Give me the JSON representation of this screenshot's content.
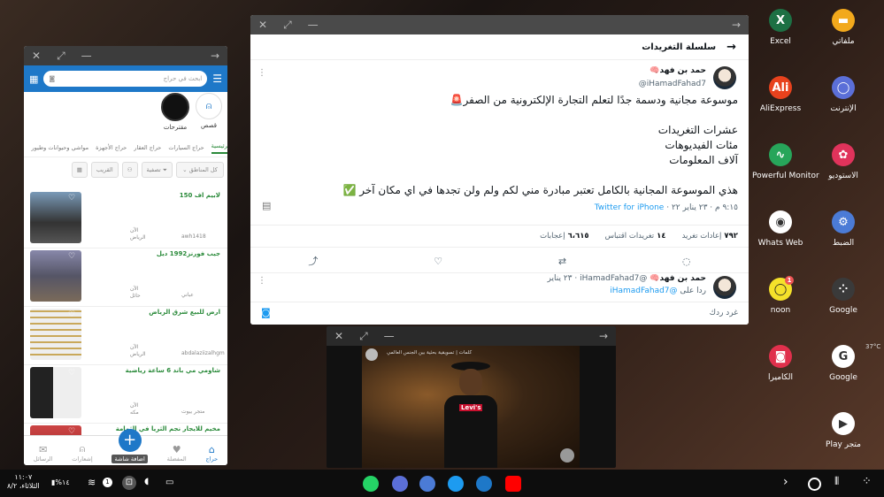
{
  "desktop": {
    "apps": [
      {
        "label": "Excel",
        "icon": "excel-icon",
        "color": "#1d7044",
        "glyph": "X"
      },
      {
        "label": "ملفاتي",
        "icon": "folder-icon",
        "color": "#f2a91c",
        "glyph": "▬"
      },
      {
        "label": "AliExpress",
        "icon": "aliexpress-icon",
        "color": "#e8421d",
        "glyph": "Ali"
      },
      {
        "label": "الإنترنت",
        "icon": "browser-icon",
        "color": "#5b6fd8",
        "glyph": "◯"
      },
      {
        "label": "Powerful Monitor",
        "icon": "monitor-icon",
        "color": "#27a55a",
        "glyph": "∿"
      },
      {
        "label": "الاستوديو",
        "icon": "gallery-icon",
        "color": "#e0335b",
        "glyph": "✿"
      },
      {
        "label": "Whats Web",
        "icon": "whatsweb-icon",
        "color": "#ffffff",
        "glyph": "◉"
      },
      {
        "label": "الضبط",
        "icon": "settings-icon",
        "color": "#4b7bd6",
        "glyph": "⚙"
      },
      {
        "label": "noon",
        "icon": "noon-icon",
        "color": "#f5e12a",
        "glyph": "◯"
      },
      {
        "label": "Google",
        "icon": "google-folder-icon",
        "color": "#3a3a3a",
        "glyph": "⁘"
      },
      {
        "label": "الكاميرا",
        "icon": "camera-icon",
        "color": "#e0304c",
        "glyph": "◙"
      },
      {
        "label": "Google",
        "icon": "google-icon",
        "color": "#ffffff",
        "glyph": "G"
      },
      {
        "label": "Play متجر",
        "icon": "play-store-icon",
        "color": "#ffffff",
        "glyph": "▶"
      }
    ],
    "noon_badge": "1",
    "temperature": "37°C"
  },
  "haraj": {
    "search_placeholder": "ابحث في حراج",
    "stories": [
      {
        "label": "مقترحات"
      },
      {
        "label": "قصص"
      }
    ],
    "tabs": [
      "الرئيسية",
      "حراج السيارات",
      "حراج العقار",
      "حراج الأجهزة",
      "مواشي وحيوانات وطيور"
    ],
    "filters": {
      "region": "كل المناطق",
      "filter": "تصفية",
      "nearby": "القريب"
    },
    "posts": [
      {
        "title": "لابيم اف 150",
        "user": "awh1418",
        "time": "الآن",
        "city": "الرياض"
      },
      {
        "title": "جيب فورنز1992 ديل",
        "user": "عباني",
        "time": "الآن",
        "city": "حائل"
      },
      {
        "title": "ارض للبيع شرق الرياض",
        "user": "abdalaziizalhgm",
        "time": "الآن",
        "city": "الرياض"
      },
      {
        "title": "شاومي مي باند 6 ساعة رياضية",
        "user": "متجر بيوت",
        "time": "الآن",
        "city": "مكه"
      },
      {
        "title": "مخيم للايجار نجم الثريا في الثمامة"
      }
    ],
    "nav": [
      "حراج",
      "المفضلة",
      "اضافة شاشة",
      "إشعارات",
      "الرسائل"
    ]
  },
  "twitter": {
    "header": "سلسلة التغريدات",
    "author_name": "حمد بن فهد🧠",
    "author_handle": "@iHamadFahad7",
    "text_lines": [
      "موسوعة مجانية ودسمة جدًا لتعلم التجارة الإلكترونية من الصفر🚨",
      "",
      "عشرات التغريدات",
      "مئات الفيديوهات",
      "آلاف المعلومات",
      "",
      "هذي الموسوعة المجانية بالكامل تعتبر مبادرة مني لكم ولم ولن تجدها في اي مكان آخر ✅"
    ],
    "time": "٩:١٥ م · ٢٣ يناير ٢٢ · ",
    "source": "Twitter for iPhone",
    "stats": [
      {
        "num": "٧٩٢",
        "label": "إعادات تغريد"
      },
      {
        "num": "١٤",
        "label": "تغريدات اقتباس"
      },
      {
        "num": "٦،٦١٥",
        "label": "إعجابات"
      }
    ],
    "reply": {
      "name": "حمد بن فهد🧠",
      "handle": "@iHamadFahad7 · ٢٣ يناير",
      "replying_to": "ردا على",
      "replying_handle": "@iHamadFahad7"
    },
    "compose_placeholder": "غرد ردك"
  },
  "video": {
    "overlay_text": "كلمات | تسويقية بحثية بين الجنس العالمي",
    "shirt_text": "Levi's"
  },
  "taskbar": {
    "time": "١١:٠٧",
    "date": "الثلاثاء، ٨/٢",
    "battery": "%١٤",
    "notif_count": "1"
  }
}
